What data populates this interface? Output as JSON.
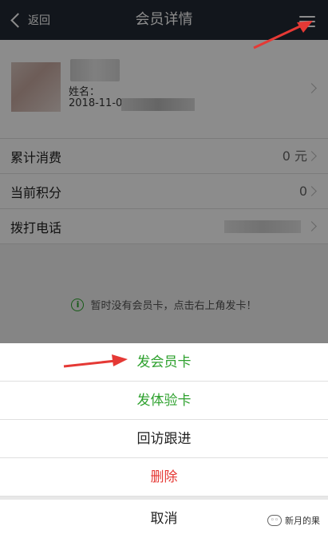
{
  "nav": {
    "back_label": "返回",
    "title": "会员详情"
  },
  "profile": {
    "name_label": "姓名：",
    "reg_date": "2018-11-0"
  },
  "list": {
    "rows": [
      {
        "label": "累计消费",
        "value": "0 元"
      },
      {
        "label": "当前积分",
        "value": "0"
      },
      {
        "label": "拨打电话",
        "value": ""
      }
    ]
  },
  "notice": {
    "text": "暂时没有会员卡，点击右上角发卡！",
    "icon": "info-icon",
    "icon_glyph": "i"
  },
  "action_sheet": {
    "items": [
      {
        "label": "发会员卡"
      },
      {
        "label": "发体验卡"
      },
      {
        "label": "回访跟进"
      },
      {
        "label": "删除"
      }
    ],
    "cancel_label": "取消"
  },
  "watermark": {
    "text": "新月的果"
  },
  "colors": {
    "nav_bg": "#222933",
    "accent_green": "#2ea12e",
    "danger_red": "#e53935",
    "annotation_red": "#e53935"
  }
}
